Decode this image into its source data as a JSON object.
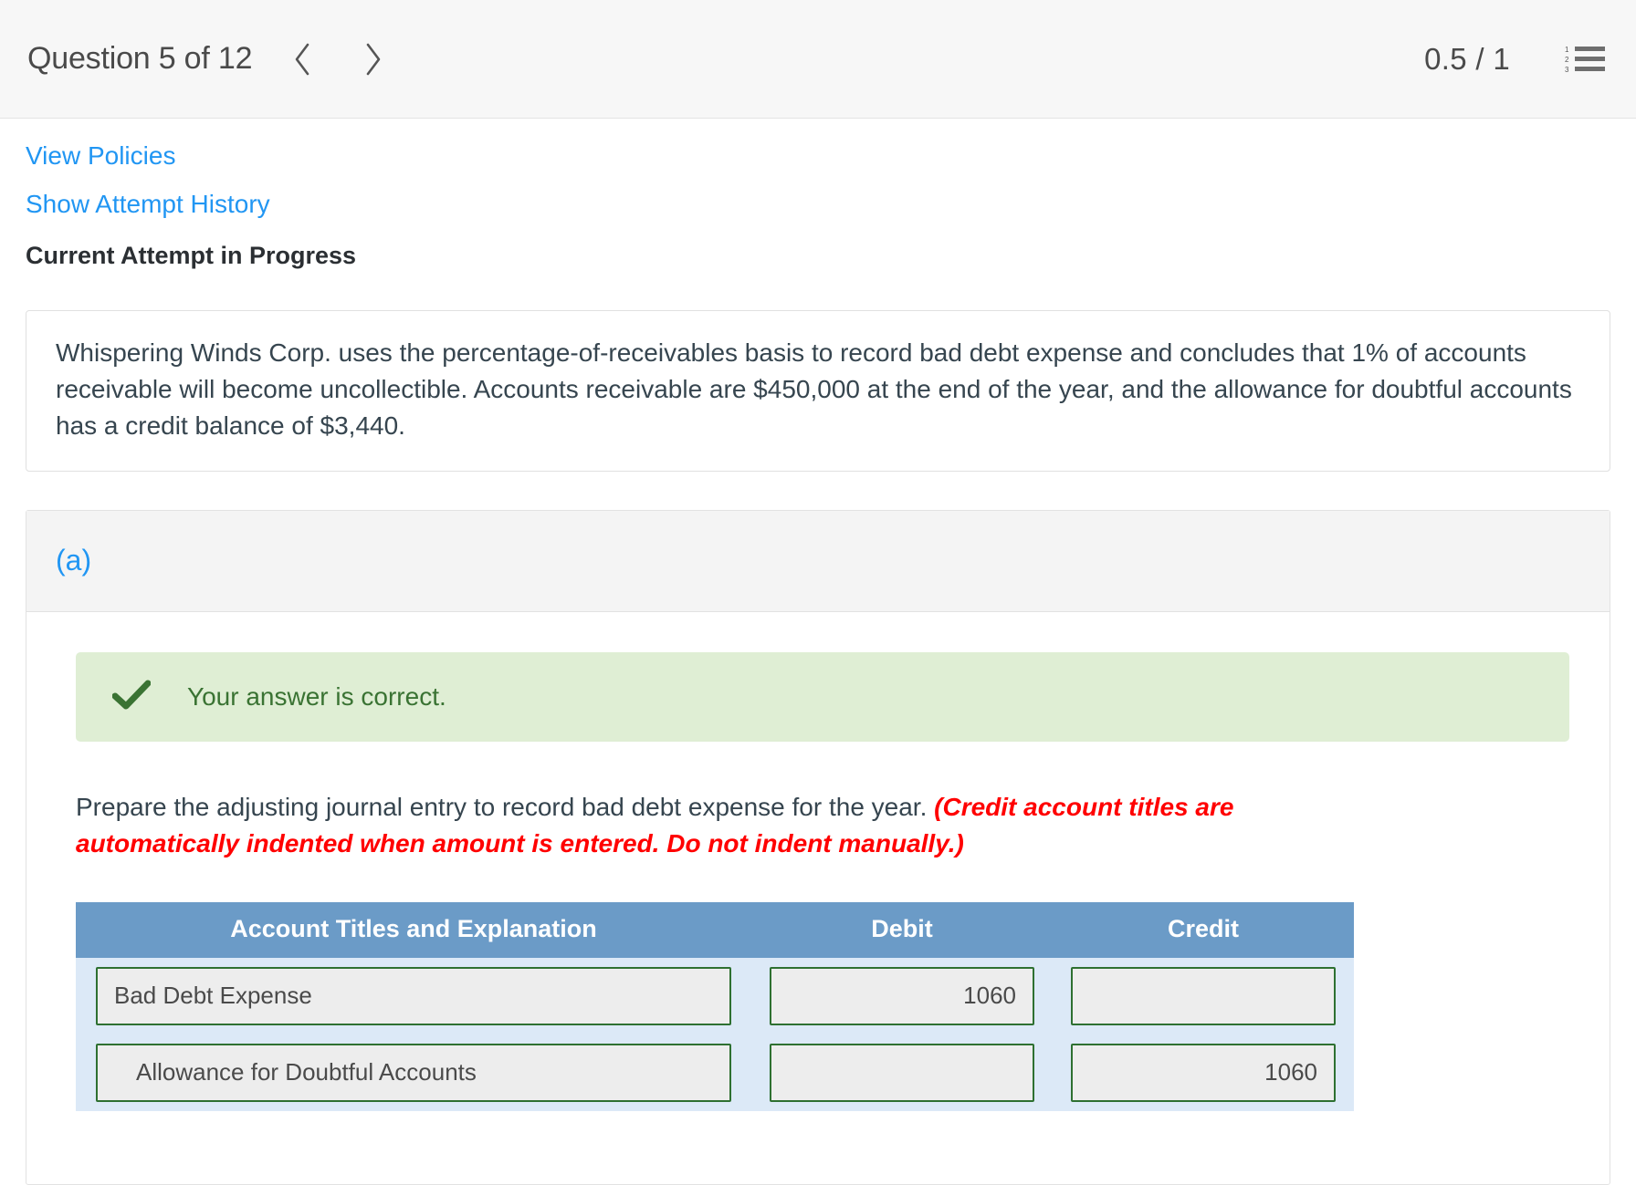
{
  "header": {
    "question_title": "Question 5 of 12",
    "prev_icon": "chevron-left-icon",
    "next_icon": "chevron-right-icon",
    "score": "0.5 / 1",
    "menu_icon": "numbered-list-icon"
  },
  "links": {
    "view_policies": "View Policies",
    "show_attempt_history": "Show Attempt History",
    "current_attempt": "Current Attempt in Progress"
  },
  "question": {
    "text": "Whispering Winds Corp. uses the percentage-of-receivables basis to record bad debt expense and concludes that 1% of accounts receivable will become uncollectible. Accounts receivable are $450,000 at the end of the year, and the allowance for doubtful accounts has a credit balance of $3,440."
  },
  "part": {
    "label": "(a)",
    "alert": {
      "icon": "checkmark-icon",
      "message": "Your answer is correct."
    },
    "instruction_main": "Prepare the adjusting journal entry to record bad debt expense for the year. ",
    "instruction_hint": "(Credit account titles are automatically indented when amount is entered. Do not indent manually.)",
    "table": {
      "headers": [
        "Account Titles and Explanation",
        "Debit",
        "Credit"
      ],
      "rows": [
        {
          "account": "Bad Debt Expense",
          "indent": false,
          "debit": "1060",
          "credit": ""
        },
        {
          "account": "Allowance for Doubtful Accounts",
          "indent": true,
          "debit": "",
          "credit": "1060"
        }
      ]
    }
  },
  "colors": {
    "link_blue": "#2196f3",
    "header_blue": "#6b9bc7",
    "row_blue": "#dce9f7",
    "input_green": "#2e7031",
    "alert_green_bg": "#dfeed4",
    "alert_green_text": "#3a7333",
    "hint_red": "#ff0000"
  }
}
